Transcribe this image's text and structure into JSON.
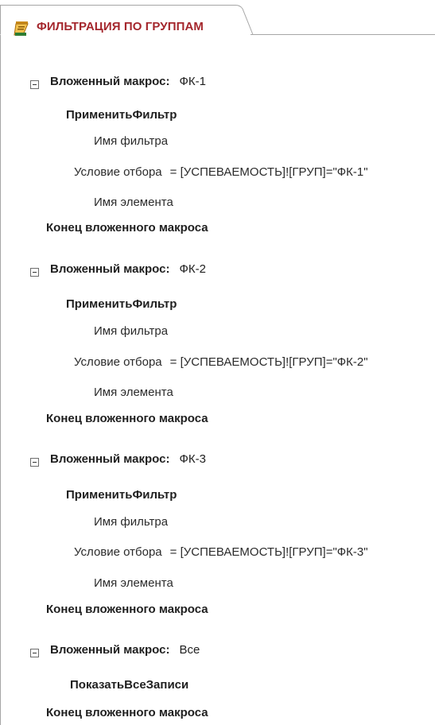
{
  "tab": {
    "title": "ФИЛЬТРАЦИЯ ПО ГРУППАМ",
    "icon": "macro-icon",
    "title_color": "#a4262c"
  },
  "submacros": [
    {
      "header_label": "Вложенный макрос:",
      "name": "ФК-1",
      "action": "ПрименитьФильтр",
      "args": [
        {
          "label": "Имя фильтра",
          "value": ""
        },
        {
          "label": "Условие отбора",
          "value": "= [УСПЕВАЕМОСТЬ]![ГРУП]=\"ФК-1\""
        },
        {
          "label": "Имя элемента",
          "value": ""
        }
      ],
      "end_label": "Конец вложенного макроса"
    },
    {
      "header_label": "Вложенный макрос:",
      "name": "ФК-2",
      "action": "ПрименитьФильтр",
      "args": [
        {
          "label": "Имя фильтра",
          "value": ""
        },
        {
          "label": "Условие отбора",
          "value": "= [УСПЕВАЕМОСТЬ]![ГРУП]=\"ФК-2\""
        },
        {
          "label": "Имя элемента",
          "value": ""
        }
      ],
      "end_label": "Конец вложенного макроса"
    },
    {
      "header_label": "Вложенный макрос:",
      "name": "ФК-3",
      "action": "ПрименитьФильтр",
      "args": [
        {
          "label": "Имя фильтра",
          "value": ""
        },
        {
          "label": "Условие отбора",
          "value": "= [УСПЕВАЕМОСТЬ]![ГРУП]=\"ФК-3\""
        },
        {
          "label": "Имя элемента",
          "value": ""
        }
      ],
      "end_label": "Конец вложенного макроса"
    },
    {
      "header_label": "Вложенный макрос:",
      "name": "Все",
      "action": "ПоказатьВсеЗаписи",
      "args": [],
      "end_label": "Конец вложенного макроса"
    }
  ]
}
